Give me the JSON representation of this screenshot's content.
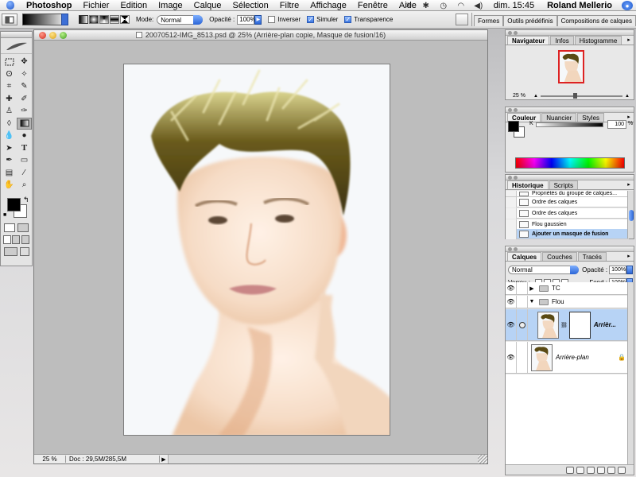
{
  "menubar": {
    "app": "Photoshop",
    "items": [
      "Fichier",
      "Edition",
      "Image",
      "Calque",
      "Sélection",
      "Filtre",
      "Affichage",
      "Fenêtre",
      "Aide"
    ],
    "clock": "dim. 15:45",
    "user": "Roland Mellerio"
  },
  "options": {
    "mode_label": "Mode:",
    "mode_value": "Normal",
    "opacity_label": "Opacité :",
    "opacity_value": "100%",
    "invert_label": "Inverser",
    "invert_checked": false,
    "simulate_label": "Simuler",
    "simulate_checked": true,
    "transparency_label": "Transparence",
    "transparency_checked": true,
    "well_tabs": [
      "Formes",
      "Outils prédéfinis",
      "Compositions de calques"
    ]
  },
  "document": {
    "title": "20070512-IMG_8513.psd @ 25% (Arrière-plan copie, Masque de fusion/16)",
    "zoom": "25 %",
    "doc_info": "Doc : 29,5M/285,5M"
  },
  "navigator": {
    "tabs": [
      "Navigateur",
      "Infos",
      "Histogramme"
    ],
    "zoom": "25 %"
  },
  "color": {
    "tabs": [
      "Couleur",
      "Nuancier",
      "Styles"
    ],
    "channel": "K",
    "value": "100",
    "unit": "%"
  },
  "history": {
    "tabs": [
      "Historique",
      "Scripts"
    ],
    "items": [
      "Propriétés du groupe de calques...",
      "Ordre des calques",
      "Ordre des calques",
      "Flou gaussien",
      "Ajouter un masque de fusion"
    ]
  },
  "layers": {
    "tabs": [
      "Calques",
      "Couches",
      "Tracés"
    ],
    "blend_mode": "Normal",
    "opacity_label": "Opacité :",
    "opacity_value": "100%",
    "lock_label": "Verrou :",
    "fill_label": "Fond :",
    "fill_value": "100%",
    "rows": [
      {
        "name": "TC",
        "kind": "group"
      },
      {
        "name": "Flou",
        "kind": "group"
      },
      {
        "name": "Arrièr...",
        "kind": "layer-with-mask"
      },
      {
        "name": "Arrière-plan",
        "kind": "background"
      }
    ]
  },
  "colors": {
    "accent": "#2a64d6",
    "selection": "#b7d3f5",
    "hair": "#5a4a14",
    "skin": "#f3dcc6"
  }
}
